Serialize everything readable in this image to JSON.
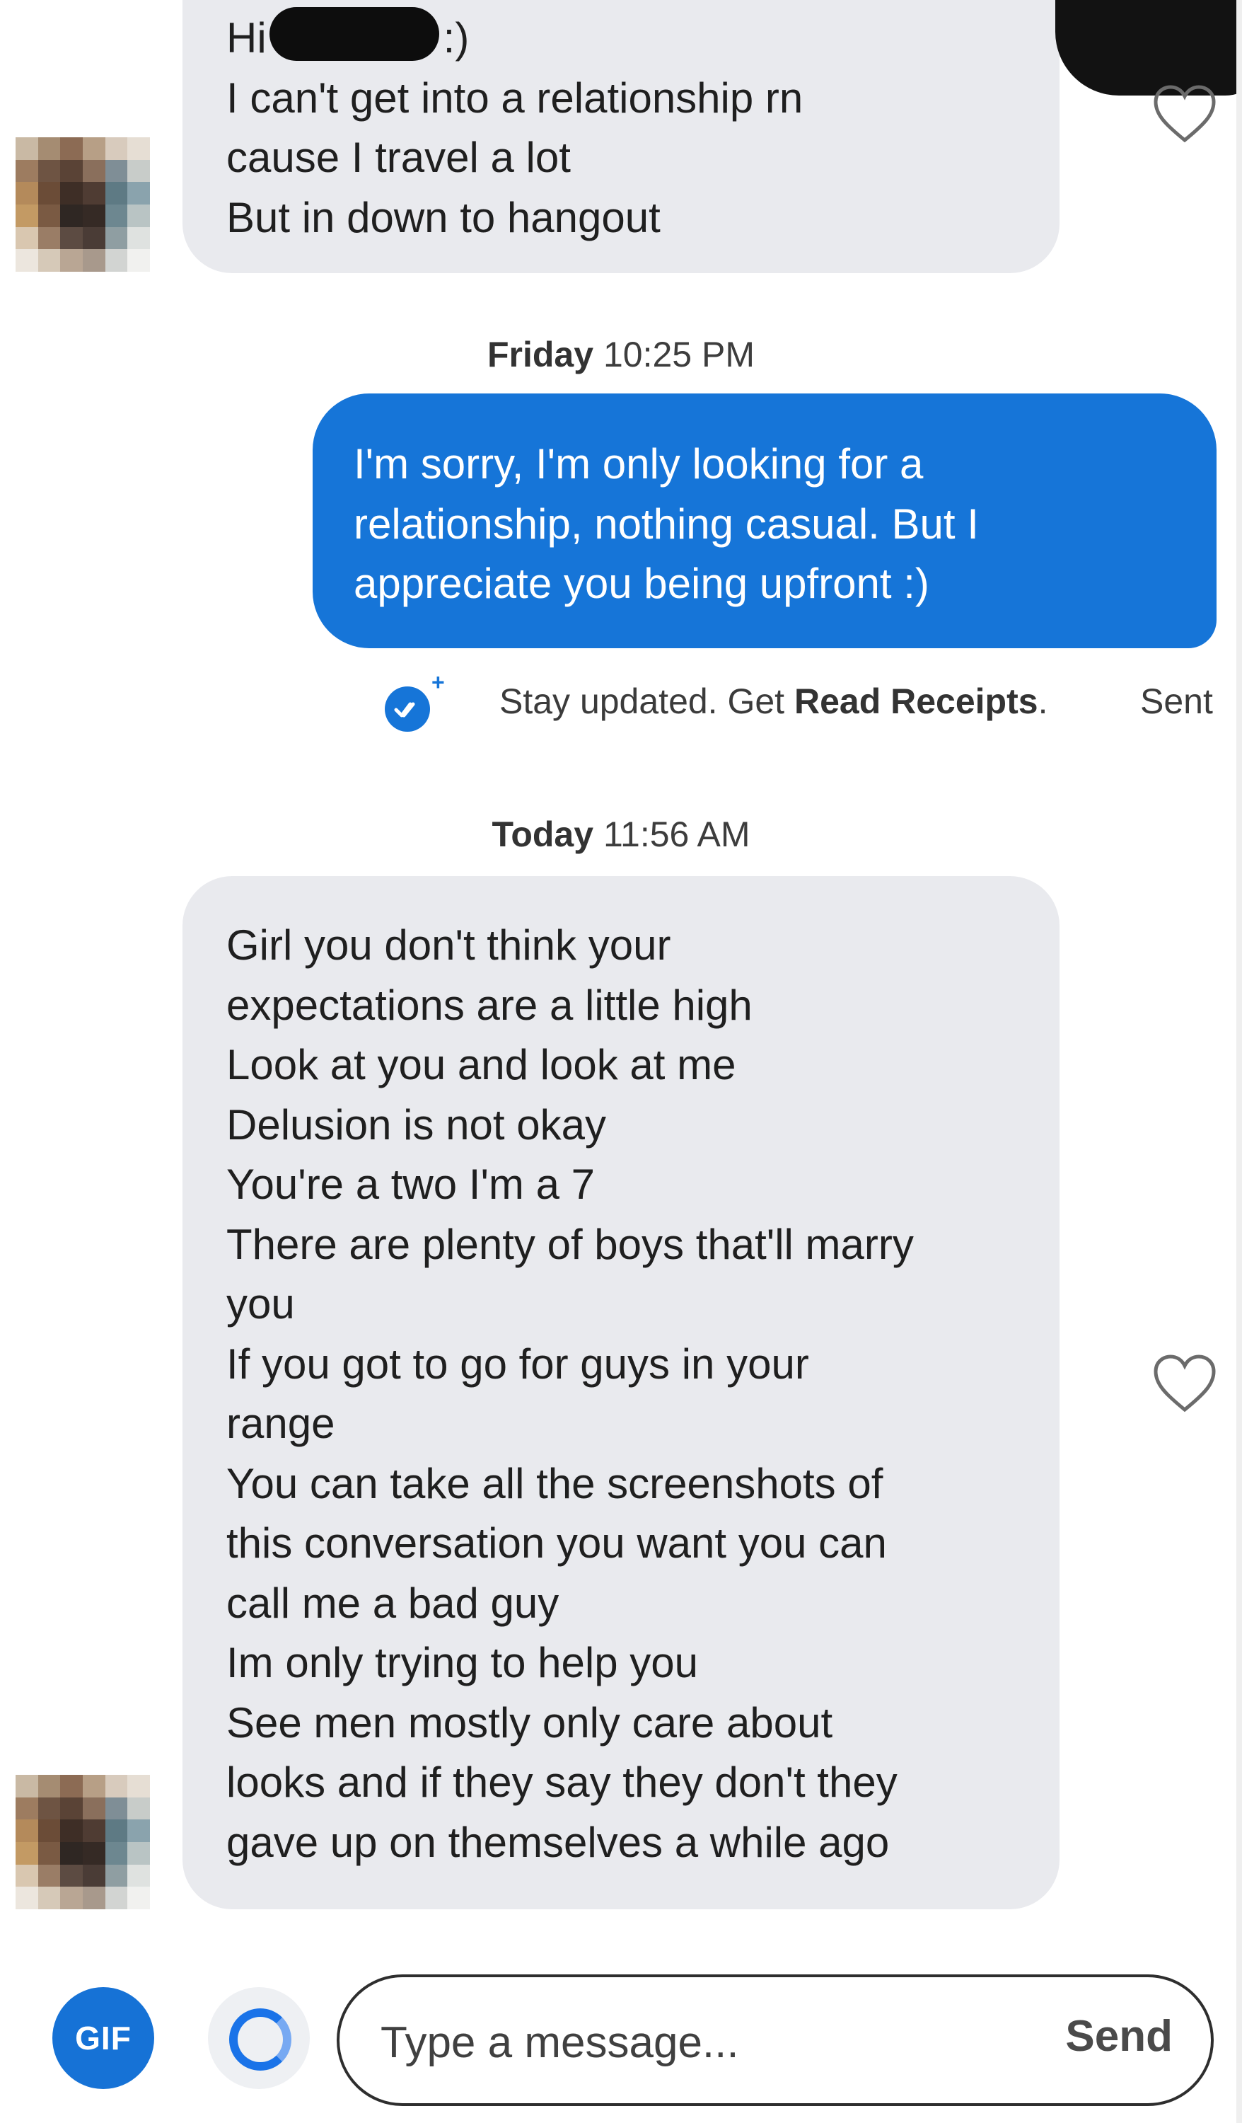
{
  "thread": {
    "first_message": {
      "greeting_prefix": "Hi",
      "greeting_suffix": ":)",
      "lines": [
        "I can't get into a relationship rn",
        "cause I travel a lot",
        "But in down to hangout"
      ]
    },
    "timestamp_1": {
      "day": "Friday",
      "time": "10:25 PM"
    },
    "reply": {
      "lines": [
        "I'm sorry, I'm only looking for a",
        "relationship, nothing casual. But I",
        "appreciate you being upfront :)"
      ]
    },
    "read_receipts": {
      "prefix": "Stay updated. Get",
      "link": "Read Receipts",
      "suffix": ".",
      "status": "Sent",
      "plus": "+"
    },
    "timestamp_2": {
      "day": "Today",
      "time": "11:56 AM"
    },
    "second_message": {
      "lines": [
        "Girl you don't think your",
        "expectations are a little high",
        "Look at you and look at me",
        "Delusion is not okay",
        "You're a two I'm a 7",
        "There are plenty of boys that'll marry",
        "you",
        "If you got to go for guys in your",
        "range",
        "You can take all the screenshots of",
        "this conversation you want you can",
        "call me a bad guy",
        "Im only trying to help you",
        "See men mostly only care about",
        "looks and if they say they don't they",
        "gave up on themselves a while ago"
      ]
    }
  },
  "composer": {
    "gif_label": "GIF",
    "input_placeholder": "Type a message...",
    "send_label": "Send"
  },
  "colors": {
    "accent": "#1675d8",
    "incoming_bubble": "#e9eaee",
    "outgoing_text": "#ffffff"
  },
  "icons": {
    "like": "heart-outline-icon",
    "read_receipt": "double-check-circle-icon",
    "loop": "loop-ring-icon"
  }
}
